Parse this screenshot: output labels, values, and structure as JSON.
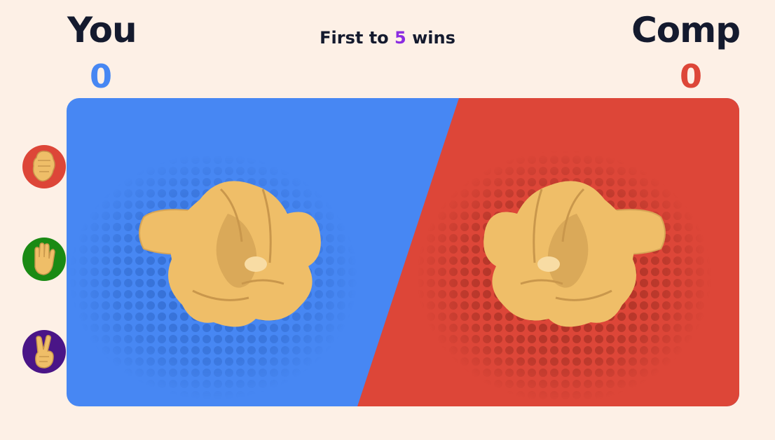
{
  "header": {
    "player_label": "You",
    "computer_label": "Comp",
    "goal_prefix": "First to ",
    "goal_target": "5",
    "goal_suffix": " wins"
  },
  "scores": {
    "player": "0",
    "computer": "0"
  },
  "choices": [
    {
      "name": "rock",
      "icon": "fist-icon",
      "color": "#dd4638"
    },
    {
      "name": "paper",
      "icon": "open-hand-icon",
      "color": "#1a8a14"
    },
    {
      "name": "scissors",
      "icon": "peace-hand-icon",
      "color": "#4a1587"
    }
  ],
  "colors": {
    "background": "#fdf0e6",
    "player_blue": "#4787f3",
    "computer_red": "#dd4638",
    "goal_purple": "#8b2be2",
    "skin": "#efbe68",
    "skin_shadow": "#c9974c"
  },
  "arena": {
    "player_hand": "rock",
    "computer_hand": "rock"
  }
}
